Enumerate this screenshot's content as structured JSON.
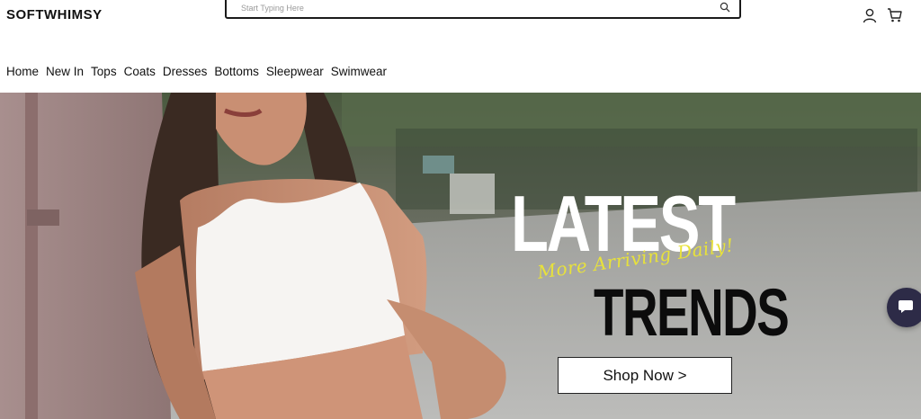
{
  "header": {
    "logo": "SOFTWHIMSY",
    "search": {
      "placeholder": "Start Typing Here",
      "icon": "search-icon"
    },
    "icons": [
      "user-icon",
      "cart-icon"
    ]
  },
  "nav": {
    "items": [
      {
        "label": "Home"
      },
      {
        "label": "New In"
      },
      {
        "label": "Tops"
      },
      {
        "label": "Coats"
      },
      {
        "label": "Dresses"
      },
      {
        "label": "Bottoms"
      },
      {
        "label": "Sleepwear"
      },
      {
        "label": "Swimwear"
      }
    ]
  },
  "hero": {
    "headline_top": "LATEST",
    "tagline": "More Arriving Daily!",
    "headline_bottom": "TRENDS",
    "cta_label": "Shop Now >",
    "colors": {
      "headline_top": "#ffffff",
      "tagline": "#e8e23a",
      "headline_bottom": "#0c0c0c"
    }
  },
  "chat": {
    "icon": "chat-bubble-icon",
    "color": "#2d2b47"
  }
}
